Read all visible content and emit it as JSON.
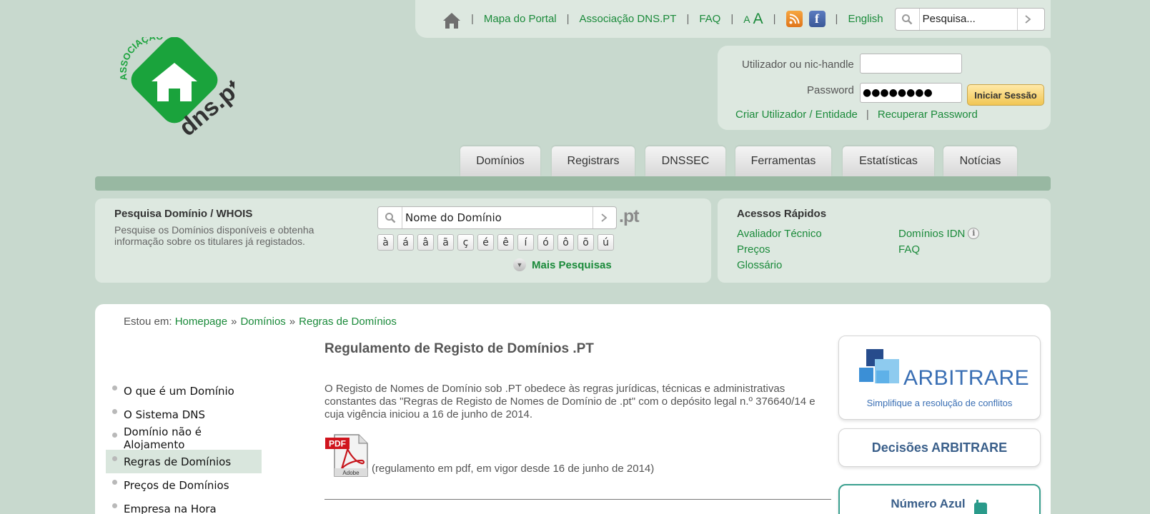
{
  "topbar": {
    "links": [
      "Mapa do Portal",
      "Associação DNS.PT",
      "FAQ"
    ],
    "font_small": "A",
    "font_large": "A",
    "language": "English",
    "search_placeholder": "Pesquisa..."
  },
  "logo": {
    "top_text": "ASSOCIAÇÃO",
    "bottom_text": "dns.pt"
  },
  "login": {
    "user_label": "Utilizador ou nic-handle",
    "user_value": "",
    "password_label": "Password",
    "password_value": "●●●●●●●●",
    "submit_label": "Iniciar Sessão",
    "create_link": "Criar Utilizador / Entidade",
    "recover_link": "Recuperar Password"
  },
  "nav": {
    "tabs": [
      "Domínios",
      "Registrars",
      "DNSSEC",
      "Ferramentas",
      "Estatísticas",
      "Notícias"
    ]
  },
  "domain_search": {
    "title": "Pesquisa Domínio / WHOIS",
    "description": "Pesquise os Domínios disponíveis e obtenha informação sobre os titulares já registados.",
    "placeholder": "Nome do Domínio",
    "suffix": ".pt",
    "special_chars": [
      "à",
      "á",
      "â",
      "ã",
      "ç",
      "é",
      "ê",
      "í",
      "ó",
      "ô",
      "õ",
      "ú"
    ],
    "more_label": "Mais Pesquisas"
  },
  "quick_access": {
    "title": "Acessos Rápidos",
    "links": [
      "Avaliador Técnico",
      "Preços",
      "Glossário",
      "Domínios IDN",
      "FAQ"
    ]
  },
  "breadcrumb": {
    "prefix": "Estou em:",
    "items": [
      "Homepage",
      "Domínios",
      "Regras de Domínios"
    ],
    "separator": "»"
  },
  "sidebar": {
    "items": [
      {
        "label": "O que é um Domínio"
      },
      {
        "label": "O Sistema DNS"
      },
      {
        "label": "Domínio não é Alojamento"
      },
      {
        "label": "Regras de Domínios"
      },
      {
        "label": "Preços de Domínios"
      },
      {
        "label": "Empresa na Hora"
      }
    ],
    "active_index": 3
  },
  "article": {
    "title": "Regulamento de Registo de Domínios .PT",
    "body": "O Registo de Nomes de Domínio sob .PT obedece às regras jurídicas, técnicas e administrativas constantes das \"Regras de Registo de Nomes de Domínio de .pt\" com o depósito legal n.º 376640/14 e cuja vigência iniciou a 16 de junho de 2014.",
    "pdf_badge": "PDF",
    "pdf_brand": "Adobe",
    "pdf_caption": "(regulamento em pdf, em vigor desde 16 de junho de 2014)"
  },
  "banners": {
    "arbitrare_name": "ARBITRARE",
    "arbitrare_tagline": "Simplifique a resolução de conflitos",
    "decisions": "Decisões ARBITRARE",
    "blue_number": "Número Azul"
  },
  "colors": {
    "link_green": "#1a8a3a",
    "background": "#c8d9ce",
    "panel": "#dde8e0",
    "nav_strip": "#98b8a2",
    "arbitrare_blue": "#3a6fb4"
  }
}
